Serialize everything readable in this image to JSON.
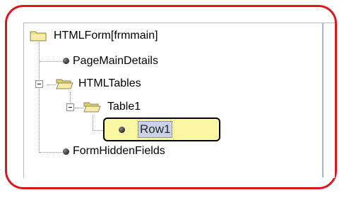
{
  "tree": {
    "root": {
      "label": "HTMLForm[frmmain]",
      "icon": "folder-icon"
    },
    "page_main_details": {
      "label": "PageMainDetails",
      "icon": "bullet-icon"
    },
    "html_tables": {
      "label": "HTMLTables",
      "icon": "folder-open-icon",
      "expanded": true
    },
    "table1": {
      "label": "Table1",
      "icon": "folder-open-icon",
      "expanded": true
    },
    "row1": {
      "label": "Row1",
      "icon": "bullet-icon",
      "selected": true
    },
    "form_hidden_fields": {
      "label": "FormHiddenFields",
      "icon": "bullet-icon"
    }
  },
  "colors": {
    "callout_border": "#e0141c",
    "highlight_fill": "#fbf7a2",
    "selection_fill": "#c9d2e8",
    "folder_yellow": "#f2e27a"
  }
}
